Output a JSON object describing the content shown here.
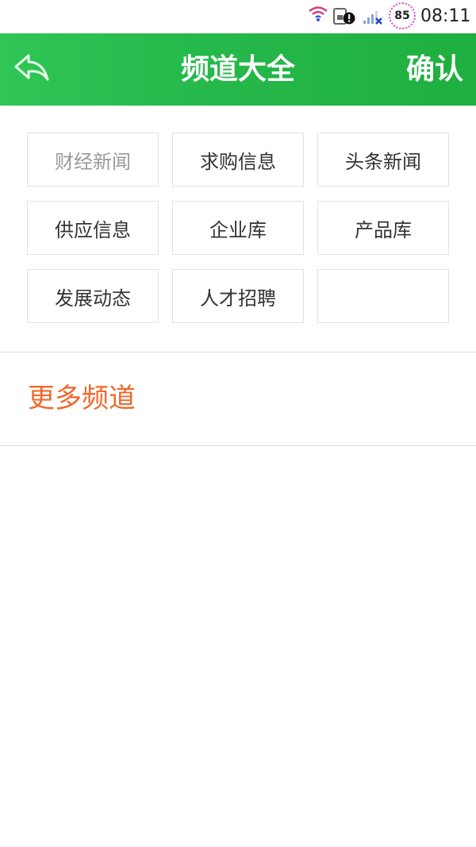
{
  "status_bar": {
    "battery_level": "85",
    "time": "08:11",
    "icons": [
      "wifi-icon",
      "sim-alert-icon",
      "signal-icon",
      "battery-icon"
    ]
  },
  "header": {
    "title": "频道大全",
    "confirm_label": "确认",
    "back_icon": "back-arrow-icon",
    "color": "#25b84a"
  },
  "channels": {
    "items": [
      {
        "label": "财经新闻",
        "selectable": false
      },
      {
        "label": "求购信息",
        "selectable": true
      },
      {
        "label": "头条新闻",
        "selectable": true
      },
      {
        "label": "供应信息",
        "selectable": true
      },
      {
        "label": "企业库",
        "selectable": true
      },
      {
        "label": "产品库",
        "selectable": true
      },
      {
        "label": "发展动态",
        "selectable": true
      },
      {
        "label": "人才招聘",
        "selectable": true
      },
      {
        "label": "",
        "selectable": true
      }
    ]
  },
  "more": {
    "title": "更多频道",
    "color": "#f0682a"
  }
}
